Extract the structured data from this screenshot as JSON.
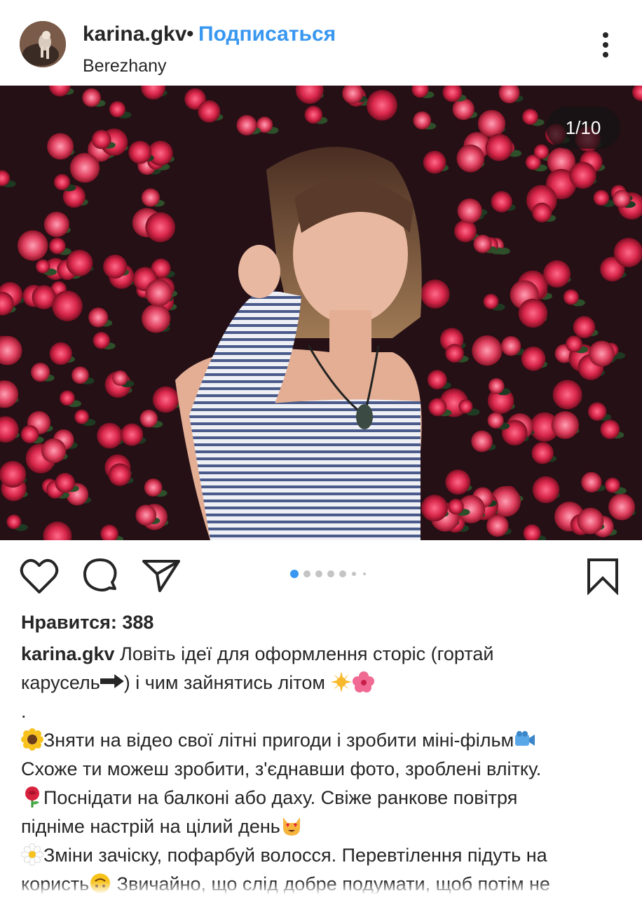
{
  "post": {
    "username": "karina.gkv",
    "separator": "•",
    "follow_label": "Подписаться",
    "location": "Berezhany",
    "counter": "1/10",
    "likes": "Нравится: 388"
  },
  "carousel": {
    "total_slides": 10,
    "current_slide": 1,
    "visible_dots": 7
  },
  "icons": {
    "more": "more-vertical-icon",
    "like": "heart-icon",
    "comment": "comment-icon",
    "share": "send-icon",
    "save": "bookmark-icon"
  },
  "colors": {
    "accent": "#3897f0",
    "text": "#262626",
    "dot_inactive": "#c4c4c4",
    "dot_active": "#3897f0"
  },
  "caption": {
    "username": "karina.gkv",
    "lines": [
      "Ловіть ідеї для оформлення сторіс (гортай",
      "карусель➡️) і чим зайнятись літом ☀️🌺",
      ".",
      "🌻Зняти на відео свої літні пригоди і зробити міні-фільм📹",
      "Схоже ти можеш зробити, з'єднавши фото, зроблені влітку.",
      "🌹Поснідати на балконі або даху. Свіже ранкове повітря",
      "підніме настрій на цілий день😻",
      "🌼Зміни зачіску, пофарбуй волосся. Перевтілення підуть на",
      "користь🙃 Звичайно, що слід добре подумати, щоб потім не"
    ],
    "line1_text": "Ловіть ідеї для оформлення сторіс (гортай",
    "line2_text": "карусель",
    "line2_text_b": ") і чим зайнятись літом ",
    "line3_text": ".",
    "line4_text": "Зняти на відео свої літні пригоди і зробити міні-фільм",
    "line5_text": "Схоже ти можеш зробити, з'єднавши фото, зроблені влітку.",
    "line6_text": "Поснідати на балконі або даху. Свіже ранкове повітря",
    "line7_text": "підніме настрій на цілий день",
    "line8_text": "Зміни зачіску, пофарбуй волосся. Перевтілення підуть на",
    "line9_text": "користь",
    "line9_text_b": " Звичайно, що слід добре подумати, щоб потім не"
  }
}
